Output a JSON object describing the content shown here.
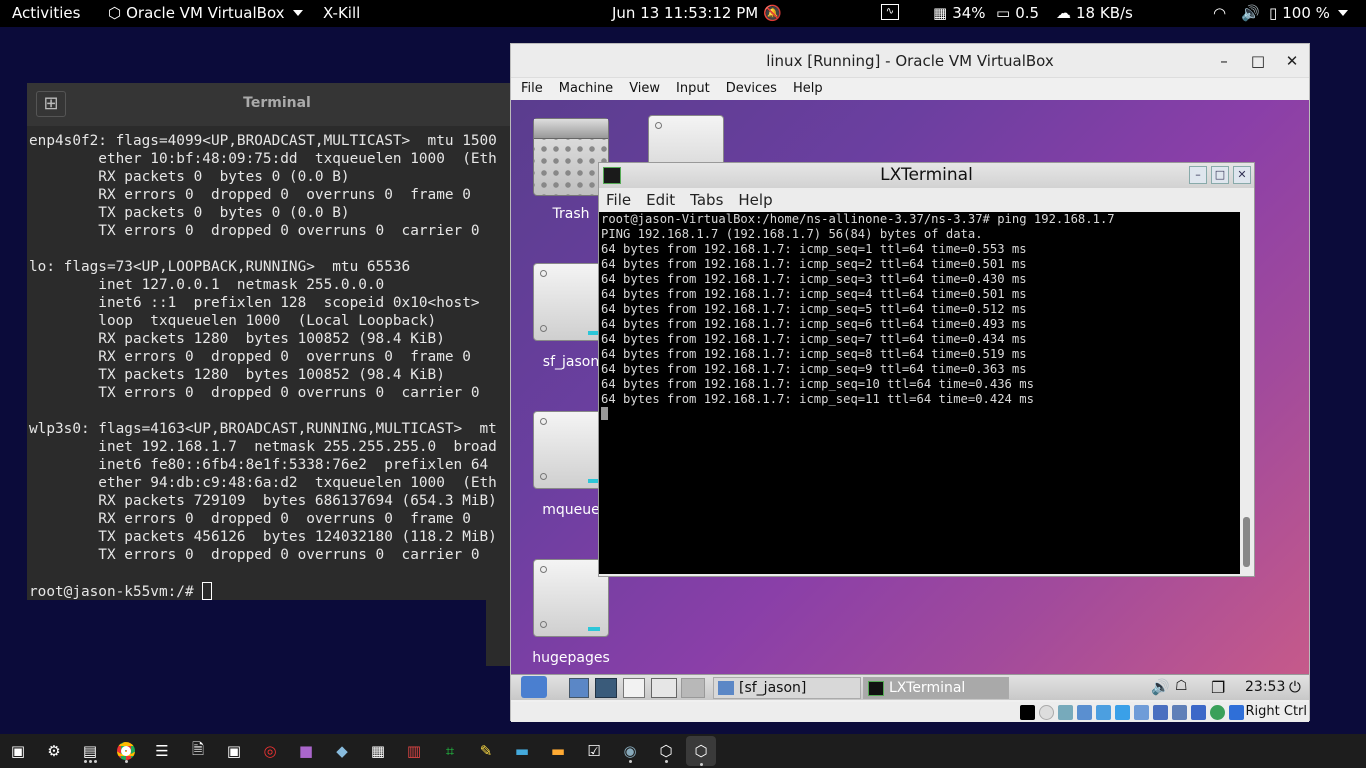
{
  "topbar": {
    "activities": "Activities",
    "app_menu": "Oracle VM VirtualBox",
    "xkill": "X-Kill",
    "datetime": "Jun 13  11:53:12 PM",
    "cpu": "34%",
    "load": "0.5",
    "net": "18 KB/s",
    "battery": "100 %"
  },
  "host_terminal": {
    "title": "Terminal",
    "lines": [
      "enp4s0f2: flags=4099<UP,BROADCAST,MULTICAST>  mtu 1500",
      "        ether 10:bf:48:09:75:dd  txqueuelen 1000  (Eth",
      "        RX packets 0  bytes 0 (0.0 B)",
      "        RX errors 0  dropped 0  overruns 0  frame 0",
      "        TX packets 0  bytes 0 (0.0 B)",
      "        TX errors 0  dropped 0 overruns 0  carrier 0",
      "",
      "lo: flags=73<UP,LOOPBACK,RUNNING>  mtu 65536",
      "        inet 127.0.0.1  netmask 255.0.0.0",
      "        inet6 ::1  prefixlen 128  scopeid 0x10<host>",
      "        loop  txqueuelen 1000  (Local Loopback)",
      "        RX packets 1280  bytes 100852 (98.4 KiB)",
      "        RX errors 0  dropped 0  overruns 0  frame 0",
      "        TX packets 1280  bytes 100852 (98.4 KiB)",
      "        TX errors 0  dropped 0 overruns 0  carrier 0",
      "",
      "wlp3s0: flags=4163<UP,BROADCAST,RUNNING,MULTICAST>  mt",
      "        inet 192.168.1.7  netmask 255.255.255.0  broad",
      "        inet6 fe80::6fb4:8e1f:5338:76e2  prefixlen 64",
      "        ether 94:db:c9:48:6a:d2  txqueuelen 1000  (Eth",
      "        RX packets 729109  bytes 686137694 (654.3 MiB)",
      "        RX errors 0  dropped 0  overruns 0  frame 0",
      "        TX packets 456126  bytes 124032180 (118.2 MiB)",
      "        TX errors 0  dropped 0 overruns 0  carrier 0",
      ""
    ],
    "prompt": "root@jason-k55vm:/# "
  },
  "vbox": {
    "title": "linux [Running] - Oracle VM VirtualBox",
    "menu": [
      "File",
      "Machine",
      "View",
      "Input",
      "Devices",
      "Help"
    ],
    "host_key": "Right Ctrl"
  },
  "guest": {
    "icons": {
      "trash": "Trash",
      "sf_jason": "sf_jason",
      "mqueue": "mqueue",
      "hugepages": "hugepages"
    },
    "lxterminal": {
      "title": "LXTerminal",
      "menu": [
        "File",
        "Edit",
        "Tabs",
        "Help"
      ],
      "lines": [
        "root@jason-VirtualBox:/home/ns-allinone-3.37/ns-3.37# ping 192.168.1.7",
        "PING 192.168.1.7 (192.168.1.7) 56(84) bytes of data.",
        "64 bytes from 192.168.1.7: icmp_seq=1 ttl=64 time=0.553 ms",
        "64 bytes from 192.168.1.7: icmp_seq=2 ttl=64 time=0.501 ms",
        "64 bytes from 192.168.1.7: icmp_seq=3 ttl=64 time=0.430 ms",
        "64 bytes from 192.168.1.7: icmp_seq=4 ttl=64 time=0.501 ms",
        "64 bytes from 192.168.1.7: icmp_seq=5 ttl=64 time=0.512 ms",
        "64 bytes from 192.168.1.7: icmp_seq=6 ttl=64 time=0.493 ms",
        "64 bytes from 192.168.1.7: icmp_seq=7 ttl=64 time=0.434 ms",
        "64 bytes from 192.168.1.7: icmp_seq=8 ttl=64 time=0.519 ms",
        "64 bytes from 192.168.1.7: icmp_seq=9 ttl=64 time=0.363 ms",
        "64 bytes from 192.168.1.7: icmp_seq=10 ttl=64 time=0.436 ms",
        "64 bytes from 192.168.1.7: icmp_seq=11 ttl=64 time=0.424 ms"
      ]
    },
    "panel": {
      "task_files": "[sf_jason]",
      "task_term": "LXTerminal",
      "clock": "23:53"
    }
  },
  "colors": {
    "host_bg": "#0b0b3a",
    "terminal_bg": "#2b2b2b",
    "guest_gradient_start": "#5a3d8e",
    "guest_gradient_end": "#c65a8a",
    "disk_led": "#2cc6d8"
  }
}
